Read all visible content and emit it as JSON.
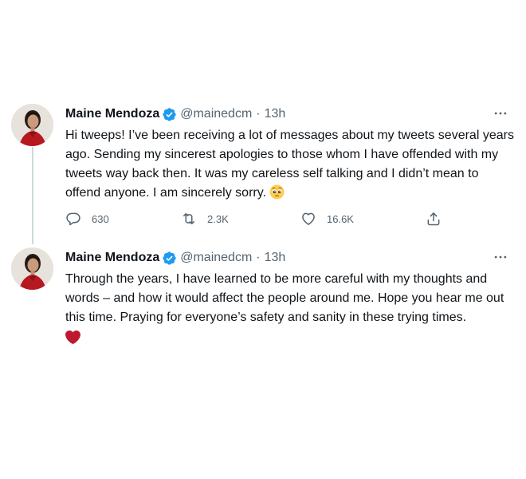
{
  "thread": {
    "tweets": [
      {
        "author_name": "Maine Mendoza",
        "handle": "@mainedcm",
        "separator": "·",
        "time": "13h",
        "text": "Hi tweeps! I’ve been receiving a lot of messages about my tweets several years ago. Sending my sincerest apologies to those whom I have offended with my tweets way back then. It was my careless self talking and I didn’t mean to offend anyone. I am sincerely sorry.",
        "emoji": "pleading-face-emoji",
        "actions": {
          "replies": "630",
          "retweets": "2.3K",
          "likes": "16.6K"
        }
      },
      {
        "author_name": "Maine Mendoza",
        "handle": "@mainedcm",
        "separator": "·",
        "time": "13h",
        "text": "Through the years, I have learned to be more careful with my thoughts and words – and how it would affect the people around me. Hope you hear me out this time. Praying for everyone’s safety and sanity in these trying times.",
        "emoji": "red-heart-emoji"
      }
    ]
  },
  "icons": {
    "verified": "verified-badge-icon",
    "more": "more-options-icon",
    "reply": "reply-icon",
    "retweet": "retweet-icon",
    "like": "like-icon",
    "share": "share-icon"
  },
  "colors": {
    "text": "#0f1419",
    "secondary": "#536471",
    "verified": "#1d9bf0",
    "thread_line": "#cfd9de",
    "heart": "#be1931"
  }
}
